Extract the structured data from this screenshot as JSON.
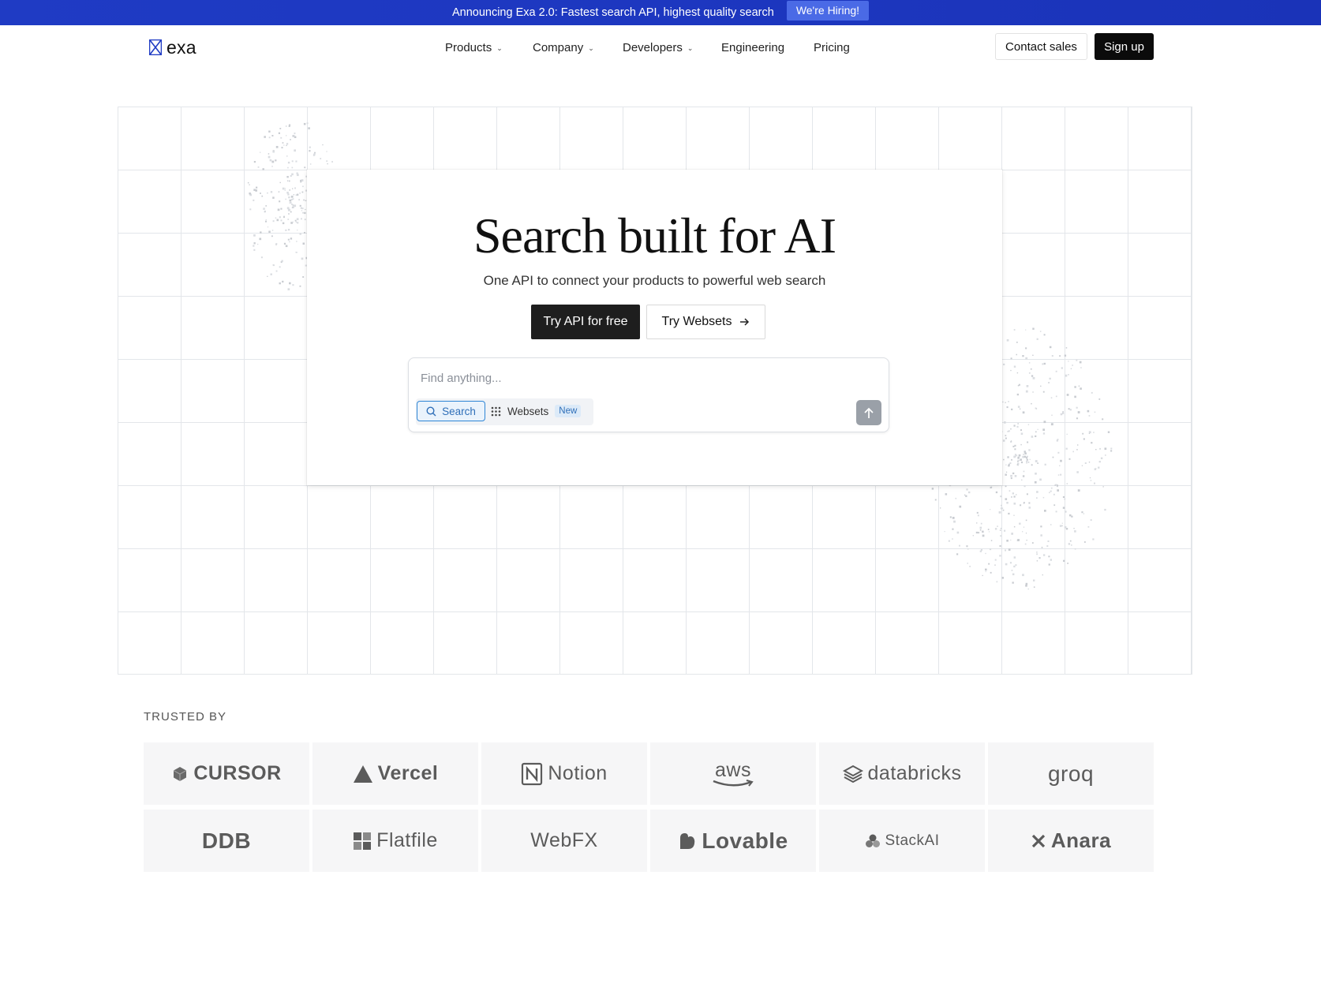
{
  "announcement": {
    "text": "Announcing Exa 2.0: Fastest search API, highest quality search",
    "hiring_label": "We're Hiring!"
  },
  "nav": {
    "logo_text": "exa",
    "items": [
      {
        "label": "Products",
        "has_dropdown": true
      },
      {
        "label": "Company",
        "has_dropdown": true
      },
      {
        "label": "Developers",
        "has_dropdown": true
      },
      {
        "label": "Engineering",
        "has_dropdown": false
      },
      {
        "label": "Pricing",
        "has_dropdown": false
      }
    ],
    "contact_label": "Contact sales",
    "signup_label": "Sign up"
  },
  "hero": {
    "title": "Search built for AI",
    "subtitle": "One API to connect your products to powerful web search",
    "primary_cta": "Try API for free",
    "secondary_cta": "Try Websets",
    "secondary_cta_icon": "arrow-right-icon"
  },
  "search": {
    "placeholder": "Find anything...",
    "modes": [
      {
        "label": "Search",
        "icon": "search-icon",
        "selected": true
      },
      {
        "label": "Websets",
        "icon": "grid-dots-icon",
        "selected": false,
        "badge": "New"
      }
    ],
    "submit_icon": "arrow-up-icon"
  },
  "trusted": {
    "label": "TRUSTED BY",
    "logos": [
      "CURSOR",
      "Vercel",
      "Notion",
      "aws",
      "databricks",
      "groq",
      "DDB",
      "Flatfile",
      "WebFX",
      "Lovable",
      "StackAI",
      "Anara"
    ]
  },
  "colors": {
    "announcement_bg": "#1d37c0",
    "primary_button": "#1e1e1e",
    "accent_blue": "#2f86d6",
    "logo_tile_bg": "#f6f6f7"
  }
}
